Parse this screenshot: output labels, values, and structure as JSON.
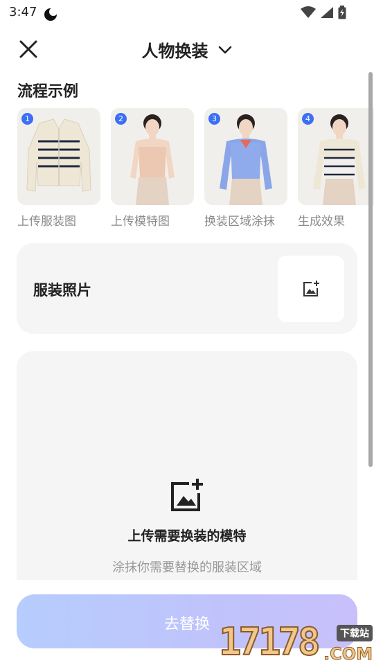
{
  "status_bar": {
    "time": "3:47"
  },
  "header": {
    "title": "人物换装"
  },
  "section": {
    "title": "流程示例"
  },
  "steps": [
    {
      "number": "1",
      "label": "上传服装图"
    },
    {
      "number": "2",
      "label": "上传模特图"
    },
    {
      "number": "3",
      "label": "换装区域涂抹"
    },
    {
      "number": "4",
      "label": "生成效果"
    }
  ],
  "garment_card": {
    "label": "服装照片"
  },
  "model_card": {
    "title": "上传需要换装的模特",
    "subtitle": "涂抹你需要替换的服装区域"
  },
  "primary_button": {
    "label": "去替换"
  },
  "watermark": {
    "digits": "17178",
    "tag": "下载站",
    "domain": ".COM"
  },
  "colors": {
    "badge": "#3d6ff5",
    "button_gradient_start": "#b6cdfd",
    "button_gradient_end": "#c9c0fb",
    "card_bg": "#f5f5f5"
  }
}
